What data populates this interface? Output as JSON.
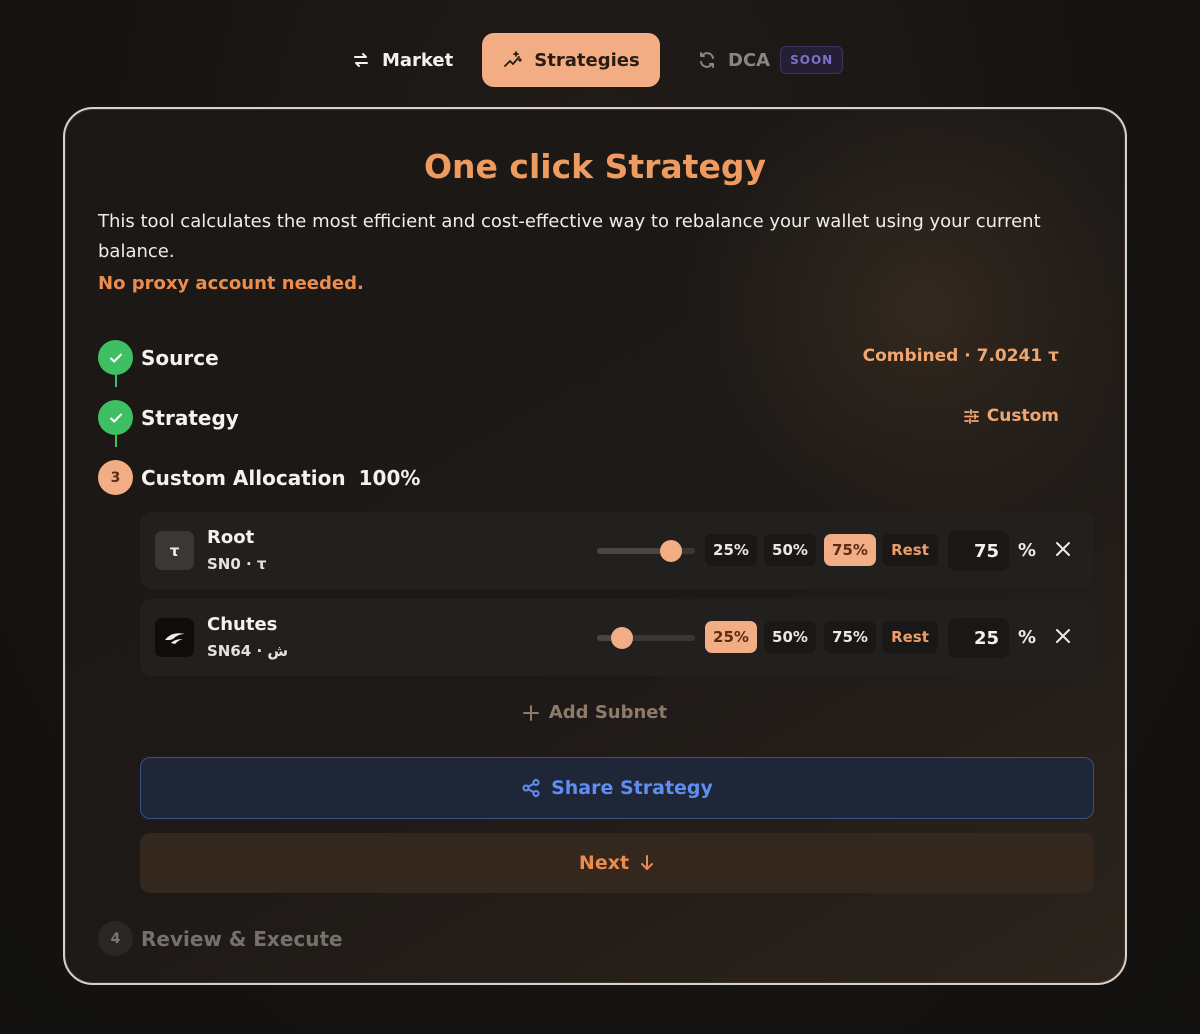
{
  "nav": {
    "market_label": "Market",
    "strategies_label": "Strategies",
    "dca_label": "DCA",
    "dca_badge": "SOON"
  },
  "card": {
    "title": "One click Strategy",
    "description": "This tool calculates the most efficient and cost-effective way to rebalance your wallet using your current balance.",
    "notice": "No proxy account needed."
  },
  "steps": {
    "source": {
      "label": "Source",
      "value": "Combined · 7.0241 τ"
    },
    "strategy": {
      "label": "Strategy",
      "value": "Custom"
    },
    "allocation": {
      "number": "3",
      "label": "Custom Allocation",
      "total": "100%"
    },
    "review": {
      "number": "4",
      "label": "Review & Execute"
    }
  },
  "allocations": [
    {
      "icon_text": "τ",
      "name": "Root",
      "id": "SN0 · τ",
      "level": 0.75,
      "buttons": [
        "25%",
        "50%",
        "75%",
        "Rest"
      ],
      "active": "75%",
      "value": "75",
      "unit": "%"
    },
    {
      "icon_name": "chutes-logo-icon",
      "name": "Chutes",
      "id": "SN64 · ش",
      "level": 0.25,
      "buttons": [
        "25%",
        "50%",
        "75%",
        "Rest"
      ],
      "active": "25%",
      "value": "25",
      "unit": "%"
    }
  ],
  "actions": {
    "add_subnet": "Add Subnet",
    "share": "Share Strategy",
    "next": "Next"
  },
  "colors": {
    "accent": "#f3ad84",
    "accent_text": "#ef9b5f",
    "success": "#3fbf63",
    "share_blue": "#5f8ef3"
  }
}
